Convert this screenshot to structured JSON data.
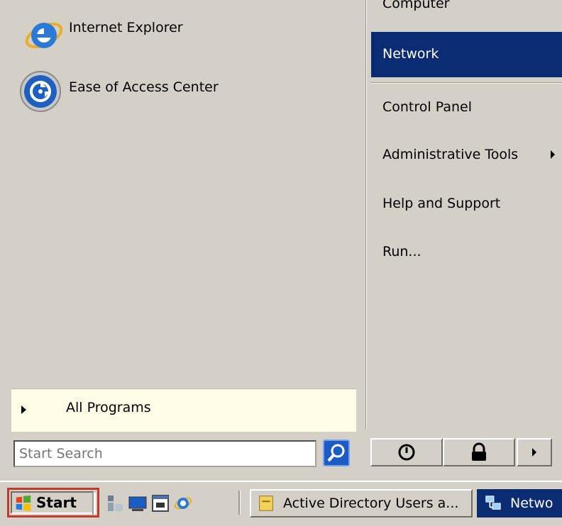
{
  "left_pane": {
    "pinned": [
      {
        "label": "Internet Explorer",
        "icon": "internet-explorer-icon"
      },
      {
        "label": "Ease of Access Center",
        "icon": "ease-of-access-icon"
      }
    ],
    "all_programs": "All Programs"
  },
  "right_pane": {
    "items": [
      {
        "label": "Computer"
      },
      {
        "label": "Network"
      },
      {
        "label": "Control Panel"
      },
      {
        "label": "Administrative Tools"
      },
      {
        "label": "Help and Support"
      },
      {
        "label": "Run..."
      }
    ]
  },
  "search": {
    "placeholder": "Start Search"
  },
  "taskbar": {
    "start_label": "Start",
    "buttons": [
      {
        "label": "Active Directory Users a..."
      },
      {
        "label": "Netwo"
      }
    ]
  },
  "colors": {
    "menu_background": "#d4d0c8",
    "highlight": "#0b2b72",
    "all_programs_bg": "#fffde5",
    "start_outline": "#c0392b"
  }
}
